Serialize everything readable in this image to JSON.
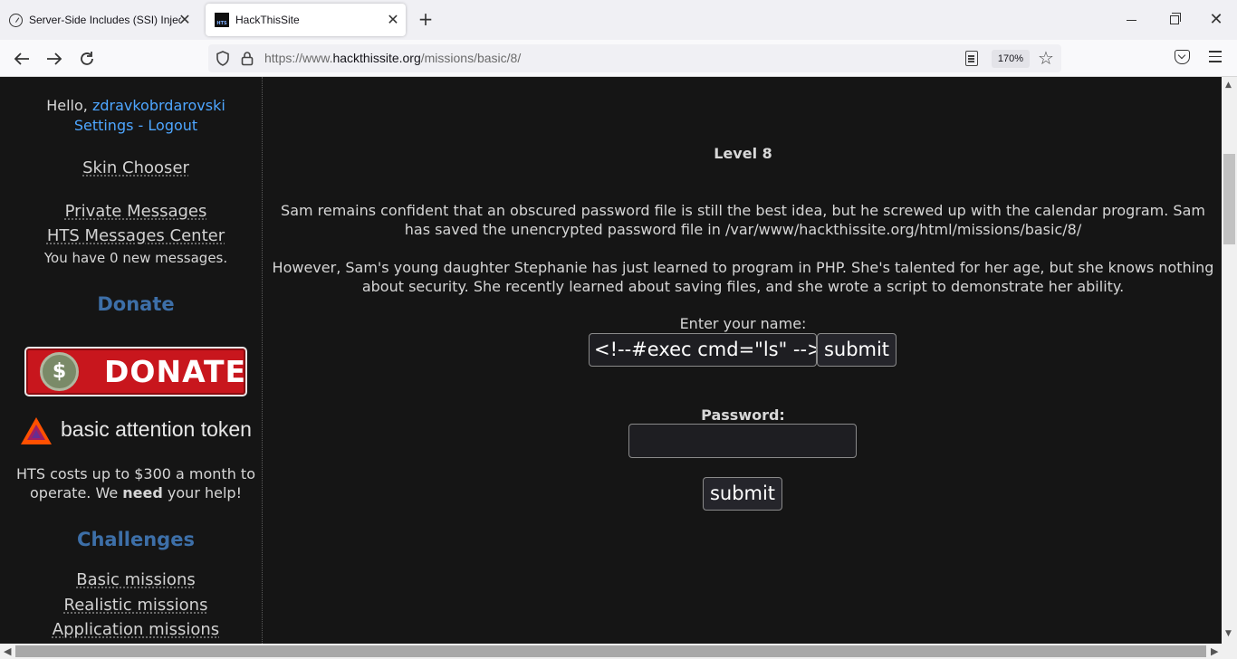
{
  "browser": {
    "tabs": [
      {
        "title": "Server-Side Includes (SSI) Injection"
      },
      {
        "title": "HackThisSite",
        "favicon_text": "HTS"
      }
    ],
    "url_prefix": "https://www.",
    "url_host": "hackthissite.org",
    "url_path": "/missions/basic/8/",
    "zoom": "170%"
  },
  "sidebar": {
    "greeting_prefix": "Hello, ",
    "username": "zdravkobrdarovski",
    "settings": "Settings",
    "separator": " - ",
    "logout": "Logout",
    "skin_chooser": "Skin Chooser",
    "private_messages": "Private Messages",
    "hts_messages_center": "HTS Messages Center",
    "new_messages": "You have 0 new messages.",
    "donate_heading": "Donate",
    "donate_button_text": "DONATE",
    "donate_coin_symbol": "$",
    "bat_text": "basic attention token",
    "costs_before": "HTS costs up to $300 a month to operate. We ",
    "costs_bold": "need",
    "costs_after": " your help!",
    "challenges_heading": "Challenges",
    "challenges": {
      "basic": "Basic missions",
      "realistic": "Realistic missions",
      "application": "Application missions"
    }
  },
  "main": {
    "level_title": "Level 8",
    "paragraph1": "Sam remains confident that an obscured password file is still the best idea, but he screwed up with the calendar program. Sam has saved the unencrypted password file in /var/www/hackthissite.org/html/missions/basic/8/",
    "paragraph2": "However, Sam's young daughter Stephanie has just learned to program in PHP. She's talented for her age, but she knows nothing about security. She recently learned about saving files, and she wrote a script to demonstrate her ability.",
    "name_label": "Enter your name:",
    "name_value": "<!--#exec cmd=\"ls\" -->",
    "name_submit": "submit",
    "password_label": "Password:",
    "password_value": "",
    "password_submit": "submit"
  },
  "colors": {
    "page_bg": "#151515",
    "link_blue": "#4ea6ff",
    "heading_blue": "#3d6fa8",
    "donate_red": "#c8161d"
  }
}
